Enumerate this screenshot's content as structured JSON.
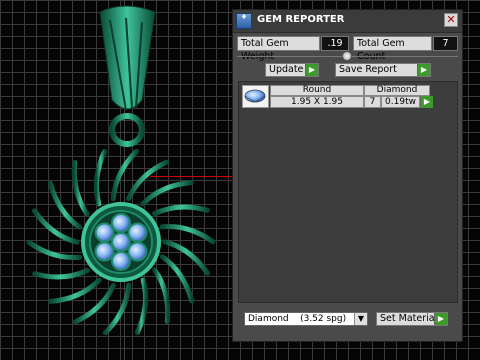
{
  "window": {
    "title": "GEM REPORTER"
  },
  "stats": {
    "weight_label": "Total Gem Weight",
    "weight_value": ".19",
    "count_label": "Total Gem Count",
    "count_value": "7"
  },
  "actions": {
    "update_label": "Update",
    "save_label": "Save Report",
    "set_material_label": "Set Material"
  },
  "gem_table": {
    "columns": [
      "Round",
      "Diamond"
    ],
    "row": {
      "size": "1.95 X 1.95",
      "count": "7",
      "weight": "0.19tw"
    }
  },
  "material": {
    "selected": "Diamond    (3.52 spg)"
  },
  "icons": {
    "go": "▶",
    "close": "✕",
    "dropdown": "▼"
  },
  "colors": {
    "panel": "#4a4a4a",
    "go_green": "#3c9a2a",
    "gem_blue": "#7fb0f0",
    "pendant_green": "#1f8a6a"
  }
}
